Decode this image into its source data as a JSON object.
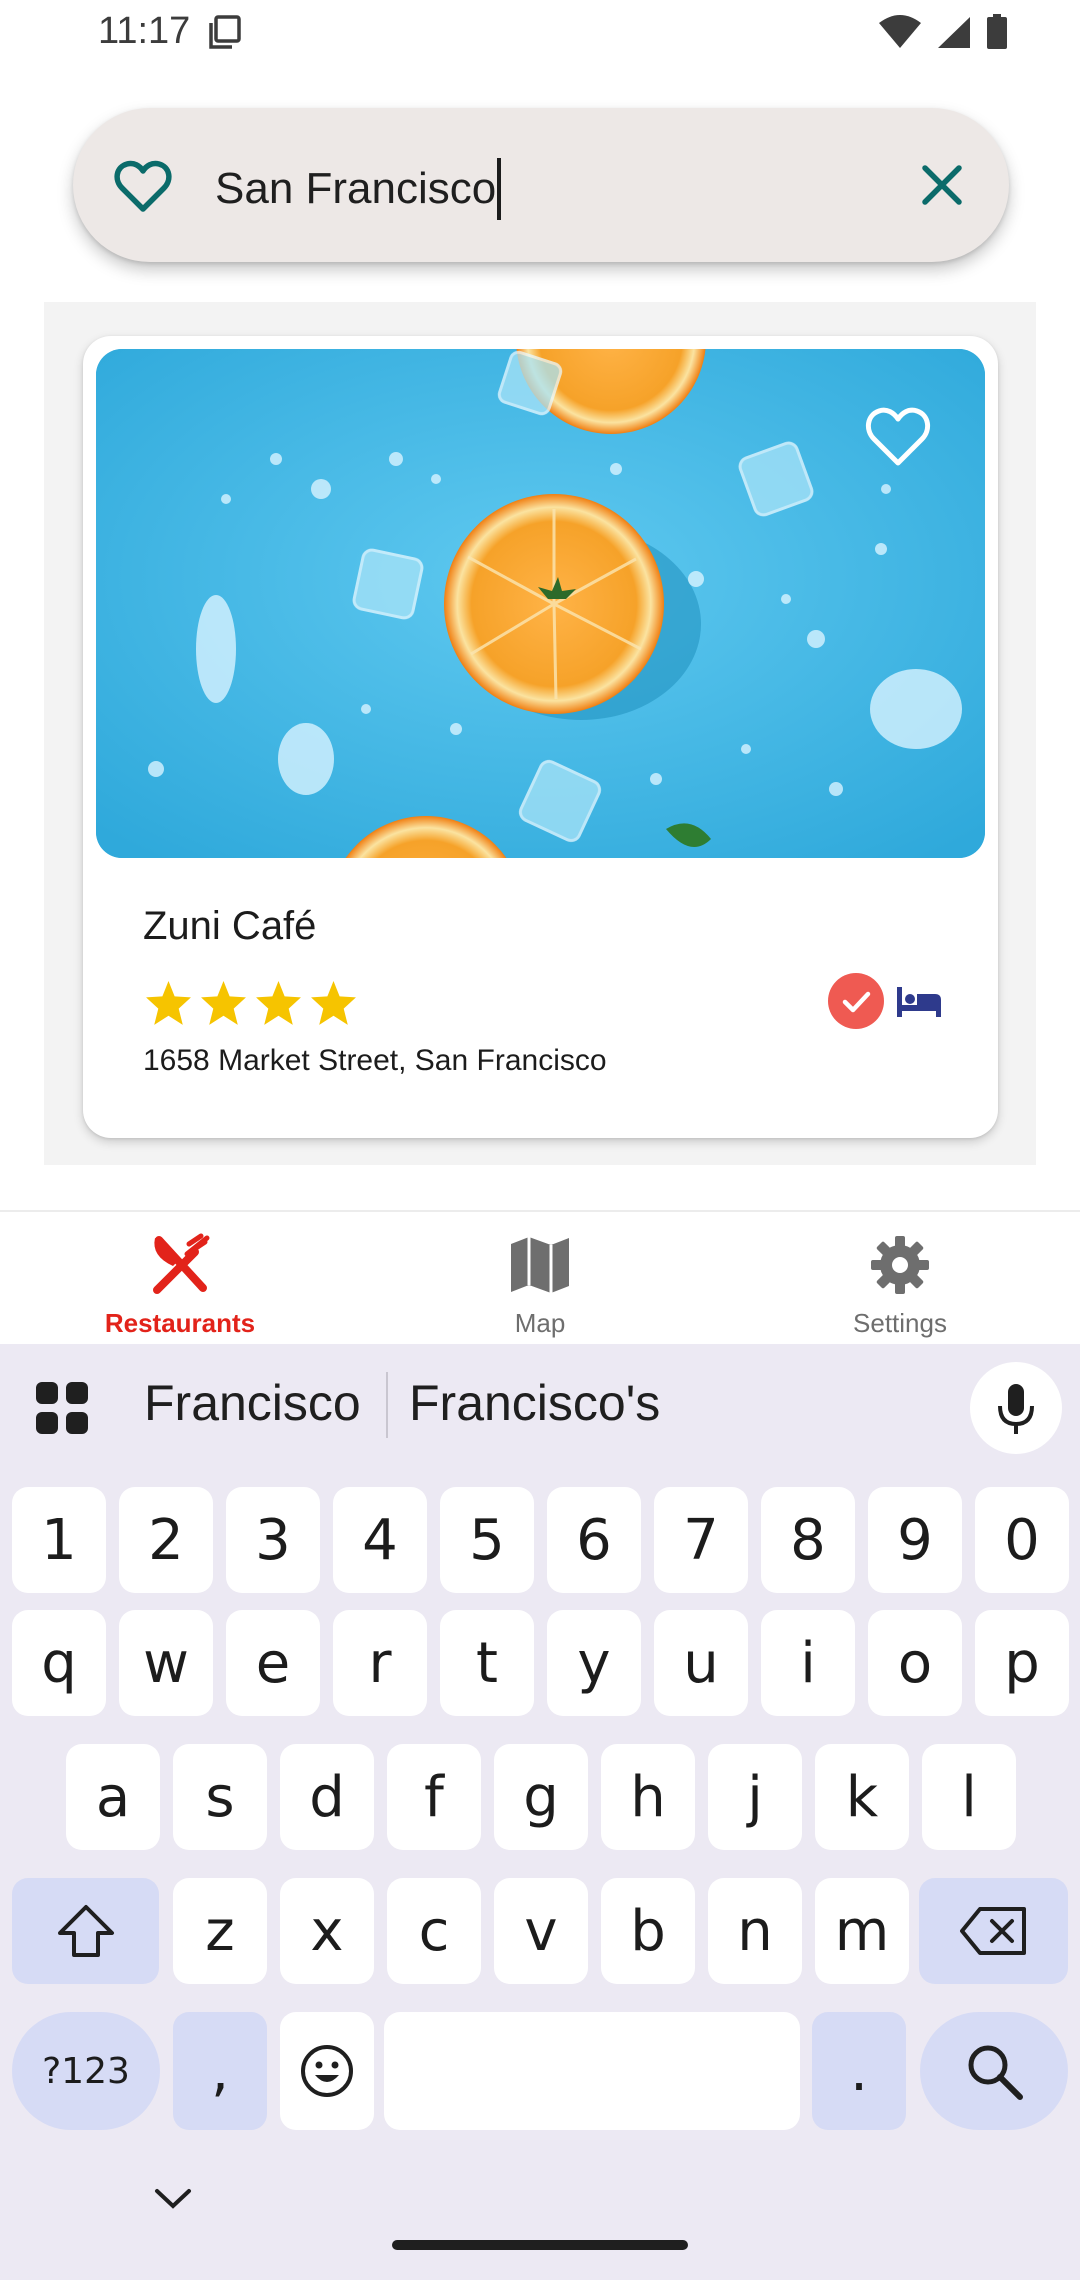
{
  "status_bar": {
    "time": "11:17",
    "icons": [
      "screenshot-icon",
      "wifi-icon",
      "signal-icon",
      "battery-icon"
    ]
  },
  "search": {
    "query": "San Francisco",
    "leading_icon": "heart-outline-icon",
    "trailing_icon": "close-icon"
  },
  "restaurant_card": {
    "name": "Zuni Café",
    "rating": 4,
    "address": "1658 Market Street, San Francisco",
    "image_description_icon": "oranges-photo",
    "favorite_icon": "heart-outline-icon",
    "amenity_icons": [
      "check-circle-icon",
      "bed-icon"
    ]
  },
  "bottom_nav": {
    "items": [
      {
        "label": "Restaurants",
        "icon": "restaurant-icon",
        "active": true
      },
      {
        "label": "Map",
        "icon": "map-icon",
        "active": false
      },
      {
        "label": "Settings",
        "icon": "gear-icon",
        "active": false
      }
    ]
  },
  "keyboard": {
    "suggestions": [
      "Francisco",
      "Francisco's"
    ],
    "rows": {
      "numbers": [
        "1",
        "2",
        "3",
        "4",
        "5",
        "6",
        "7",
        "8",
        "9",
        "0"
      ],
      "row1": [
        "q",
        "w",
        "e",
        "r",
        "t",
        "y",
        "u",
        "i",
        "o",
        "p"
      ],
      "row2": [
        "a",
        "s",
        "d",
        "f",
        "g",
        "h",
        "j",
        "k",
        "l"
      ],
      "row3": [
        "z",
        "x",
        "c",
        "v",
        "b",
        "n",
        "m"
      ]
    },
    "symbols_label": "?123",
    "comma": ",",
    "period": "."
  },
  "colors": {
    "accent_red": "#e2231a",
    "teal": "#0b6b6a",
    "nav_inactive": "#6e6e6e",
    "keyboard_bg": "#ece9f3",
    "mod_key": "#d6dbf5",
    "bed_blue": "#2e3a8c"
  }
}
